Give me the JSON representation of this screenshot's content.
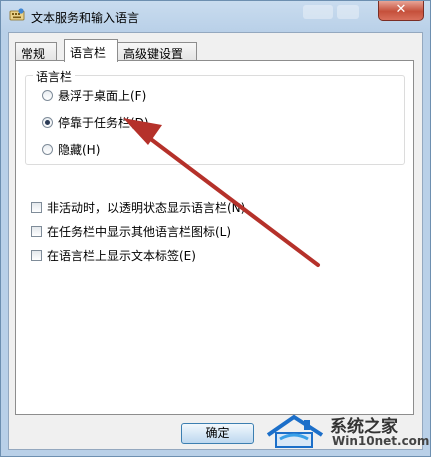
{
  "window": {
    "title": "文本服务和输入语言",
    "close_glyph": "✕"
  },
  "tabs": [
    {
      "label": "常规"
    },
    {
      "label": "语言栏"
    },
    {
      "label": "高级键设置"
    }
  ],
  "active_tab": "语言栏",
  "language_bar": {
    "group_label": "语言栏",
    "options": [
      {
        "label": "悬浮于桌面上(F)",
        "selected": false
      },
      {
        "label": "停靠于任务栏(D)",
        "selected": true
      },
      {
        "label": "隐藏(H)",
        "selected": false
      }
    ]
  },
  "checkboxes": [
    {
      "label": "非活动时，以透明状态显示语言栏(N)",
      "checked": false
    },
    {
      "label": "在任务栏中显示其他语言栏图标(L)",
      "checked": false
    },
    {
      "label": "在语言栏上显示文本标签(E)",
      "checked": false
    }
  ],
  "buttons": {
    "ok_label": "确定"
  },
  "annotation": {
    "arrow_color": "#b5312a",
    "points_to": "停靠于任务栏(D)"
  },
  "watermark": {
    "brand": "系统之家",
    "url": "Win10net.com"
  }
}
